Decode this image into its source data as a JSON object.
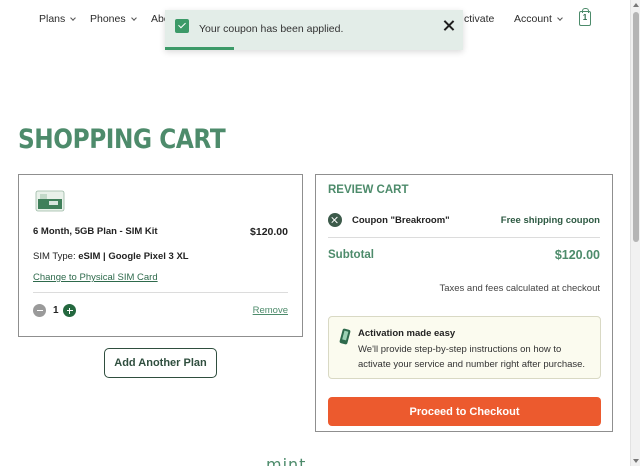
{
  "nav": {
    "items": [
      {
        "label": "Plans"
      },
      {
        "label": "Phones"
      },
      {
        "label": "Abo"
      },
      {
        "label": "ctivate"
      },
      {
        "label": "Account"
      }
    ],
    "cart_count": "1"
  },
  "toast": {
    "message": "Your coupon has been applied.",
    "progress": 0.23
  },
  "page": {
    "title": "SHOPPING CART"
  },
  "cart_item": {
    "name": "6 Month, 5GB Plan - SIM Kit",
    "price": "$120.00",
    "sim_type_label": "SIM Type: ",
    "sim_type_value": "eSIM | Google Pixel 3 XL",
    "change_link": "Change to Physical SIM Card",
    "quantity": "1",
    "remove_label": "Remove"
  },
  "add_plan_label": "Add Another Plan",
  "review": {
    "title": "REVIEW CART",
    "coupon_name": "Coupon \"Breakroom\"",
    "coupon_desc": "Free shipping coupon",
    "subtotal_label": "Subtotal",
    "subtotal_value": "$120.00",
    "tax_note": "Taxes and fees calculated at checkout",
    "activation_title": "Activation made easy",
    "activation_text": "We'll provide step-by-step instructions on how to activate your service and number right after purchase.",
    "checkout_label": "Proceed to Checkout"
  },
  "footer": {
    "logo_partial": "mint"
  },
  "colors": {
    "brand_green": "#4d8b6b",
    "dark_green": "#2e6a4c",
    "checkout_orange": "#ec5a2e",
    "toast_bg": "#e3ede8"
  },
  "icons": [
    "chevron-down-icon",
    "cart-icon",
    "check-icon",
    "close-icon",
    "minus-icon",
    "plus-icon",
    "remove-coupon-icon",
    "phone-icon"
  ]
}
